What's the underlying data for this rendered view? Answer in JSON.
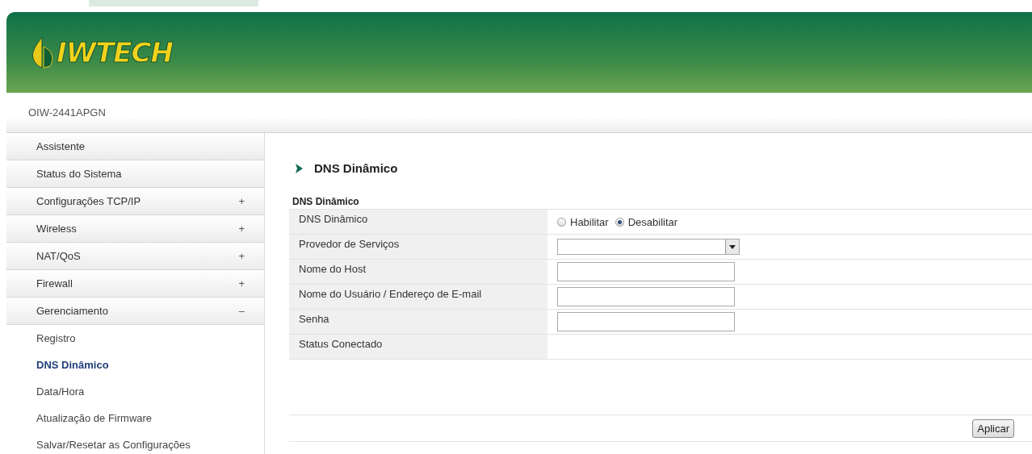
{
  "header": {
    "logo_text": "IWTECH",
    "model": "OIW-2441APGN"
  },
  "sidebar": {
    "items": [
      {
        "label": "Assistente"
      },
      {
        "label": "Status do Sistema"
      },
      {
        "label": "Configurações TCP/IP",
        "sign": "+"
      },
      {
        "label": "Wireless",
        "sign": "+"
      },
      {
        "label": "NAT/QoS",
        "sign": "+"
      },
      {
        "label": "Firewall",
        "sign": "+"
      },
      {
        "label": "Gerenciamento",
        "sign": "–",
        "children": [
          {
            "label": "Registro",
            "selected": false
          },
          {
            "label": "DNS Dinâmico",
            "selected": true
          },
          {
            "label": "Data/Hora",
            "selected": false
          },
          {
            "label": "Atualização de Firmware",
            "selected": false
          },
          {
            "label": "Salvar/Resetar as Configurações",
            "selected": false
          }
        ]
      }
    ]
  },
  "page_title": "DNS Dinâmico",
  "form": {
    "title": "DNS Dinâmico",
    "rows": [
      {
        "kind": "radio",
        "label": "DNS Dinâmico",
        "options": [
          {
            "label": "Habilitar",
            "selected": false
          },
          {
            "label": "Desabilitar",
            "selected": true
          }
        ]
      },
      {
        "kind": "select",
        "label": "Provedor de Serviços"
      },
      {
        "kind": "text",
        "label": "Nome do Host"
      },
      {
        "kind": "text",
        "label": "Nome do Usuário / Endereço de E-mail"
      },
      {
        "kind": "text",
        "label": "Senha"
      },
      {
        "kind": "status",
        "label": "Status Conectado"
      }
    ]
  },
  "apply_button": "Aplicar"
}
